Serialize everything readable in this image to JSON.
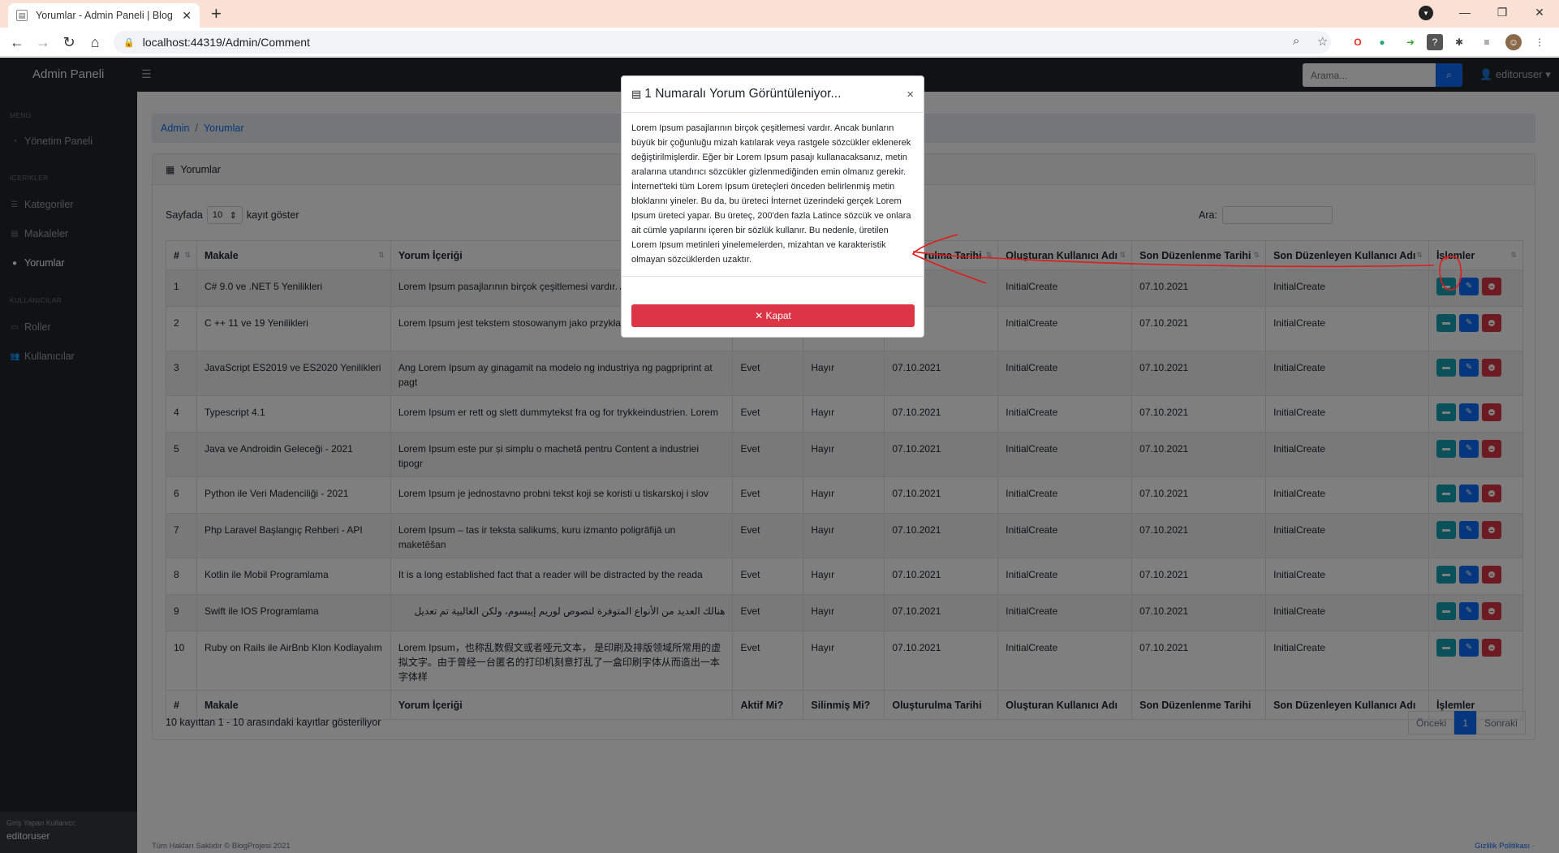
{
  "browser": {
    "tab_title": "Yorumlar - Admin Paneli | Blog Pr",
    "new_tab": "+",
    "url": "localhost:44319/Admin/Comment"
  },
  "app": {
    "brand": "Admin Paneli",
    "search_placeholder": "Arama...",
    "user": "editoruser"
  },
  "sidebar": {
    "heading_menu": "MENÜ",
    "dashboard": "Yönetim Paneli",
    "heading_content": "İÇERİKLER",
    "categories": "Kategoriler",
    "articles": "Makaleler",
    "comments": "Yorumlar",
    "heading_users": "KULLANICILAR",
    "roles": "Roller",
    "users": "Kullanıcılar",
    "footer_label": "Giriş Yapan Kullanıcı:",
    "footer_user": "editoruser"
  },
  "breadcrumb": {
    "root": "Admin",
    "sep": "/",
    "current": "Yorumlar"
  },
  "card": {
    "title": "Yorumlar",
    "length_prefix": "Sayfada",
    "length_value": "10",
    "length_suffix": "kayıt göster",
    "filter_label": "Ara:",
    "info": "10 kayıttan 1 - 10 arasındaki kayıtlar gösteriliyor",
    "prev": "Önceki",
    "page": "1",
    "next": "Sonraki"
  },
  "table": {
    "headers": [
      "#",
      "Makale",
      "Yorum İçeriği",
      "Aktif Mi?",
      "Silinmiş Mi?",
      "Oluşturulma Tarihi",
      "Oluşturan Kullanıcı Adı",
      "Son Düzenlenme Tarihi",
      "Son Düzenleyen Kullanıcı Adı",
      "İşlemler"
    ],
    "visible_header_date": "rulma Tarihi",
    "rows": [
      {
        "id": "1",
        "article": "C# 9.0 ve .NET 5 Yenilikleri",
        "content": "Lorem Ipsum pasajlarının birçok çeşitlemesi vardır. A",
        "active": "",
        "deleted": "",
        "created": "",
        "creator": "InitialCreate",
        "modified": "07.10.2021",
        "modifier": "InitialCreate"
      },
      {
        "id": "2",
        "article": "C ++ 11 ve 19 Yenilikleri",
        "content": "Lorem Ipsum jest tekstem stosowanym jako przykład przemyśle",
        "active": "",
        "deleted": "",
        "created": "",
        "creator": "InitialCreate",
        "modified": "07.10.2021",
        "modifier": "InitialCreate"
      },
      {
        "id": "3",
        "article": "JavaScript ES2019 ve ES2020 Yenilikleri",
        "content": "Ang Lorem Ipsum ay ginagamit na modelo ng industriya ng pagpriprint at pagt",
        "active": "Evet",
        "deleted": "Hayır",
        "created": "07.10.2021",
        "creator": "InitialCreate",
        "modified": "07.10.2021",
        "modifier": "InitialCreate"
      },
      {
        "id": "4",
        "article": "Typescript 4.1",
        "content": "Lorem Ipsum er rett og slett dummytekst fra og for trykkeindustrien. Lorem",
        "active": "Evet",
        "deleted": "Hayır",
        "created": "07.10.2021",
        "creator": "InitialCreate",
        "modified": "07.10.2021",
        "modifier": "InitialCreate"
      },
      {
        "id": "5",
        "article": "Java ve Androidin Geleceği - 2021",
        "content": "Lorem Ipsum este pur și simplu o machetă pentru Content a industriei tipogr",
        "active": "Evet",
        "deleted": "Hayır",
        "created": "07.10.2021",
        "creator": "InitialCreate",
        "modified": "07.10.2021",
        "modifier": "InitialCreate"
      },
      {
        "id": "6",
        "article": "Python ile Veri Madenciliği - 2021",
        "content": "Lorem Ipsum je jednostavno probni tekst koji se koristi u tiskarskoj i slov",
        "active": "Evet",
        "deleted": "Hayır",
        "created": "07.10.2021",
        "creator": "InitialCreate",
        "modified": "07.10.2021",
        "modifier": "InitialCreate"
      },
      {
        "id": "7",
        "article": "Php Laravel Başlangıç Rehberi - API",
        "content": "Lorem Ipsum – tas ir teksta salikums, kuru izmanto poligrāfijā un maketēšan",
        "active": "Evet",
        "deleted": "Hayır",
        "created": "07.10.2021",
        "creator": "InitialCreate",
        "modified": "07.10.2021",
        "modifier": "InitialCreate"
      },
      {
        "id": "8",
        "article": "Kotlin ile Mobil Programlama",
        "content": "It is a long established fact that a reader will be distracted by the reada",
        "active": "Evet",
        "deleted": "Hayır",
        "created": "07.10.2021",
        "creator": "InitialCreate",
        "modified": "07.10.2021",
        "modifier": "InitialCreate"
      },
      {
        "id": "9",
        "article": "Swift ile IOS Programlama",
        "content": "هنالك العديد من الأنواع المتوفرة لنصوص لوريم إيبسوم، ولكن الغالبية تم تعديل",
        "active": "Evet",
        "deleted": "Hayır",
        "created": "07.10.2021",
        "creator": "InitialCreate",
        "modified": "07.10.2021",
        "modifier": "InitialCreate"
      },
      {
        "id": "10",
        "article": "Ruby on Rails ile AirBnb Klon Kodlayalım",
        "content": "Lorem Ipsum，也称乱数假文或者哑元文本， 是印刷及排版领域所常用的虚拟文字。由于曾经一台匿名的打印机刻意打乱了一盒印刷字体从而造出一本字体样",
        "active": "Evet",
        "deleted": "Hayır",
        "created": "07.10.2021",
        "creator": "InitialCreate",
        "modified": "07.10.2021",
        "modifier": "InitialCreate"
      }
    ]
  },
  "footer": {
    "left": "Tüm Hakları Saklıdır © BlogProjesi 2021",
    "right": "Gizlilik Politikası ·"
  },
  "modal": {
    "title": "1 Numaralı Yorum Görüntüleniyor...",
    "close": "×",
    "body": "Lorem Ipsum pasajlarının birçok çeşitlemesi vardır. Ancak bunların büyük bir çoğunluğu mizah katılarak veya rastgele sözcükler eklenerek değiştirilmişlerdir. Eğer bir Lorem Ipsum pasajı kullanacaksanız, metin aralarına utandırıcı sözcükler gizlenmediğinden emin olmanız gerekir. İnternet'teki tüm Lorem Ipsum üreteçleri önceden belirlenmiş metin bloklarını yineler. Bu da, bu üreteci İnternet üzerindeki gerçek Lorem Ipsum üreteci yapar. Bu üreteç, 200'den fazla Latince sözcük ve onlara ait cümle yapılarını içeren bir sözlük kullanır. Bu nedenle, üretilen Lorem Ipsum metinleri yinelemelerden, mizahtan ve karakteristik olmayan sözcüklerden uzaktır.",
    "button": "✕ Kapat"
  },
  "colors": {
    "primary": "#0d6efd",
    "info": "#17a2b8",
    "danger": "#dc3545",
    "dark": "#212529",
    "annotation": "#e01b1b"
  }
}
